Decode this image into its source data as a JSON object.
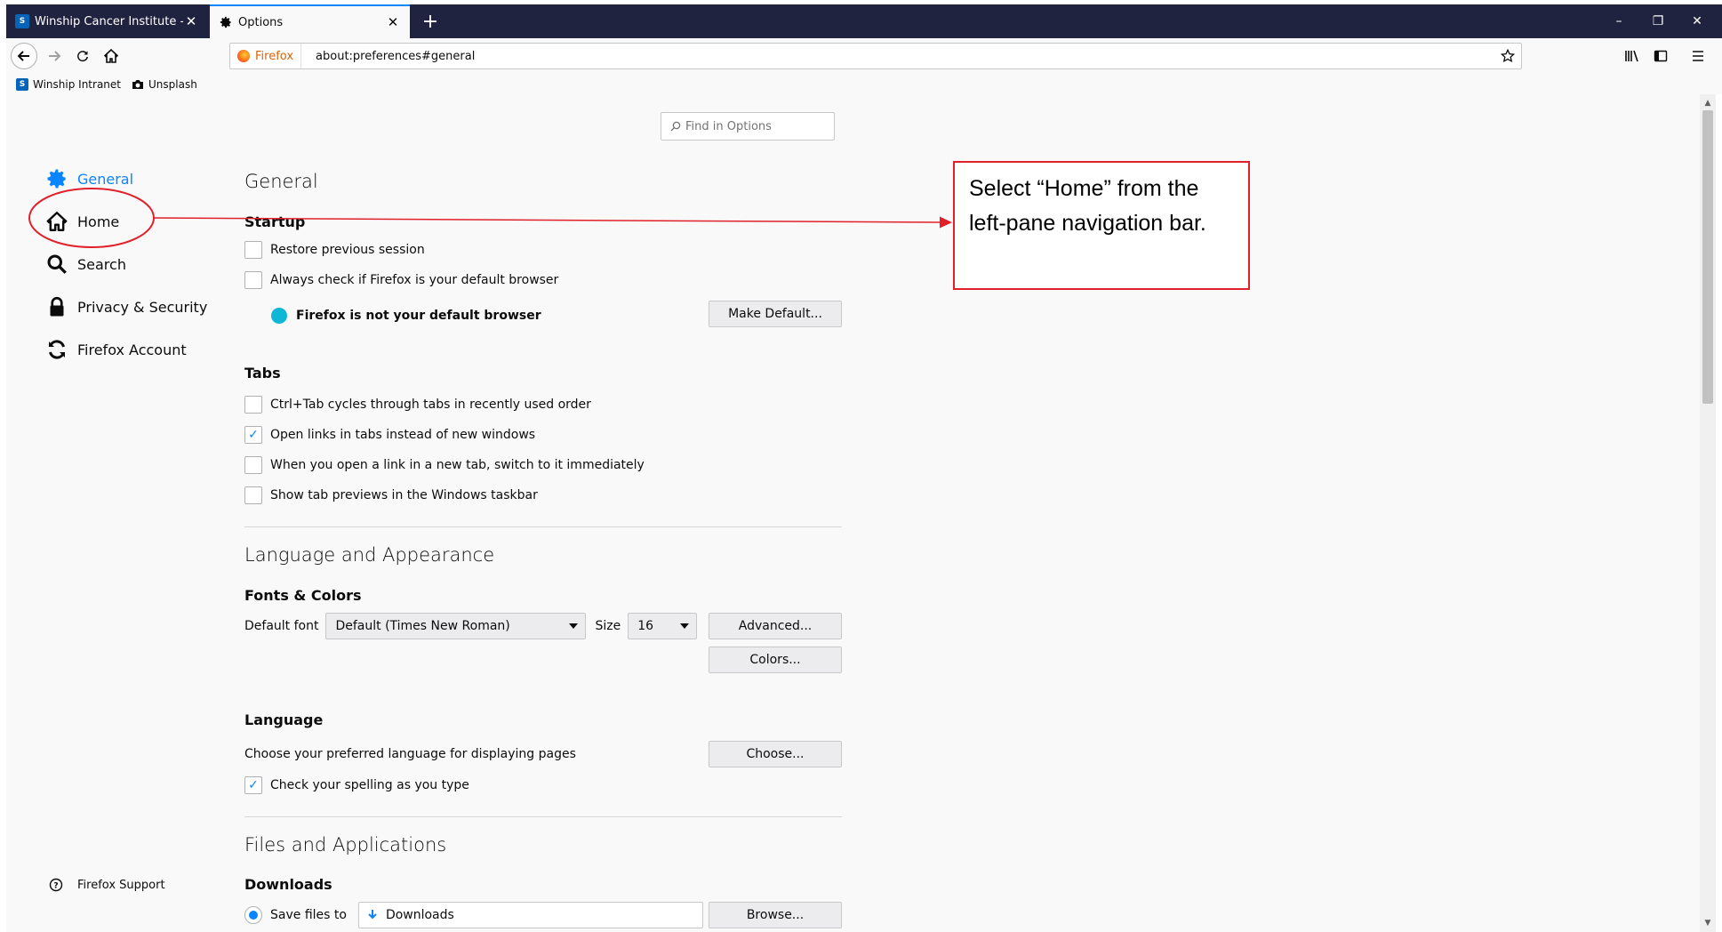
{
  "tabs": [
    {
      "title": "Winship Cancer Institute - Hom",
      "favicon": "sharepoint-icon"
    },
    {
      "title": "Options",
      "favicon": "gear-icon"
    }
  ],
  "newtab_label": "+",
  "nav": {
    "identity_label": "Firefox",
    "url": "about:preferences#general"
  },
  "bookmarks": [
    {
      "label": "Winship Intranet",
      "icon": "sharepoint-icon"
    },
    {
      "label": "Unsplash",
      "icon": "camera-icon"
    }
  ],
  "search": {
    "placeholder": "Find in Options"
  },
  "sidebar": {
    "items": [
      {
        "label": "General",
        "icon": "gear-icon",
        "selected": true
      },
      {
        "label": "Home",
        "icon": "home-icon"
      },
      {
        "label": "Search",
        "icon": "search-icon"
      },
      {
        "label": "Privacy & Security",
        "icon": "lock-icon"
      },
      {
        "label": "Firefox Account",
        "icon": "sync-icon"
      }
    ],
    "support_label": "Firefox Support"
  },
  "general": {
    "title": "General",
    "startup": {
      "heading": "Startup",
      "restore_session": "Restore previous session",
      "check_default": "Always check if Firefox is your default browser",
      "not_default": "Firefox is not your default browser",
      "make_default_btn": "Make Default..."
    },
    "tabs_section": {
      "heading": "Tabs",
      "ctrl_tab": "Ctrl+Tab cycles through tabs in recently used order",
      "open_links": "Open links in tabs instead of new windows",
      "switch_tab": "When you open a link in a new tab, switch to it immediately",
      "tab_previews": "Show tab previews in the Windows taskbar"
    },
    "appearance": {
      "title": "Language and Appearance",
      "fonts_heading": "Fonts & Colors",
      "default_font_label": "Default font",
      "default_font_value": "Default (Times New Roman)",
      "size_label": "Size",
      "size_value": "16",
      "advanced_btn": "Advanced...",
      "colors_btn": "Colors..."
    },
    "language": {
      "heading": "Language",
      "prompt": "Choose your preferred language for displaying pages",
      "choose_btn": "Choose...",
      "spelling": "Check your spelling as you type"
    },
    "files": {
      "title": "Files and Applications",
      "downloads_heading": "Downloads",
      "save_files_label": "Save files to",
      "downloads_folder": "Downloads",
      "browse_btn": "Browse..."
    }
  },
  "annotation": {
    "text": "Select “Home” from the left-pane navigation bar."
  },
  "colors": {
    "accent": "#0a84ff",
    "titlebar": "#202340",
    "annotation_red": "#e0202a"
  }
}
